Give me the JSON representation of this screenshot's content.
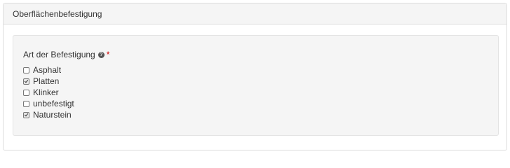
{
  "panel": {
    "title": "Oberflächenbefestigung"
  },
  "field": {
    "label": "Art der Befestigung",
    "help_icon": "question-circle-icon",
    "required_marker": "*",
    "required_color": "#cc0000"
  },
  "options": [
    {
      "label": "Asphalt",
      "checked": false
    },
    {
      "label": "Platten",
      "checked": true
    },
    {
      "label": "Klinker",
      "checked": false
    },
    {
      "label": "unbefestigt",
      "checked": false
    },
    {
      "label": "Naturstein",
      "checked": true
    }
  ]
}
